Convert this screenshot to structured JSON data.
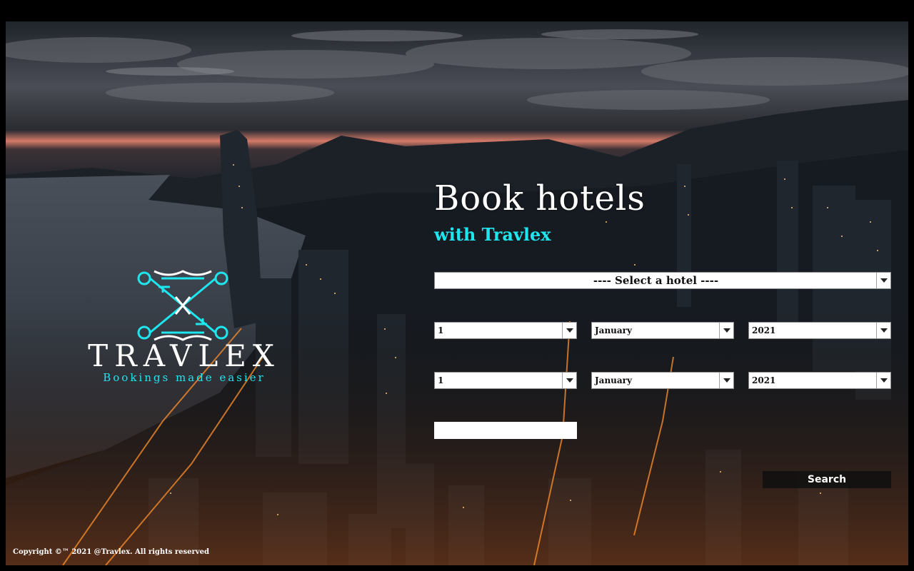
{
  "hero": {
    "title": "Book hotels",
    "subtitle": "with Travlex"
  },
  "brand": {
    "name": "TRAVLEX",
    "tagline": "Bookings made easier",
    "accent_color": "#1ee6ee"
  },
  "form": {
    "hotel_select": {
      "selected": "----  Select a hotel  ----"
    },
    "checkin": {
      "day": "1",
      "month": "January",
      "year": "2021"
    },
    "checkout": {
      "day": "1",
      "month": "January",
      "year": "2021"
    },
    "search_label": "Search"
  },
  "footer": {
    "copyright": "Copyright ©™ 2021 @Travlex. All rights reserved"
  },
  "icons": {
    "dropdown": "chevron-down-icon",
    "logo": "crossed-keys-icon"
  }
}
